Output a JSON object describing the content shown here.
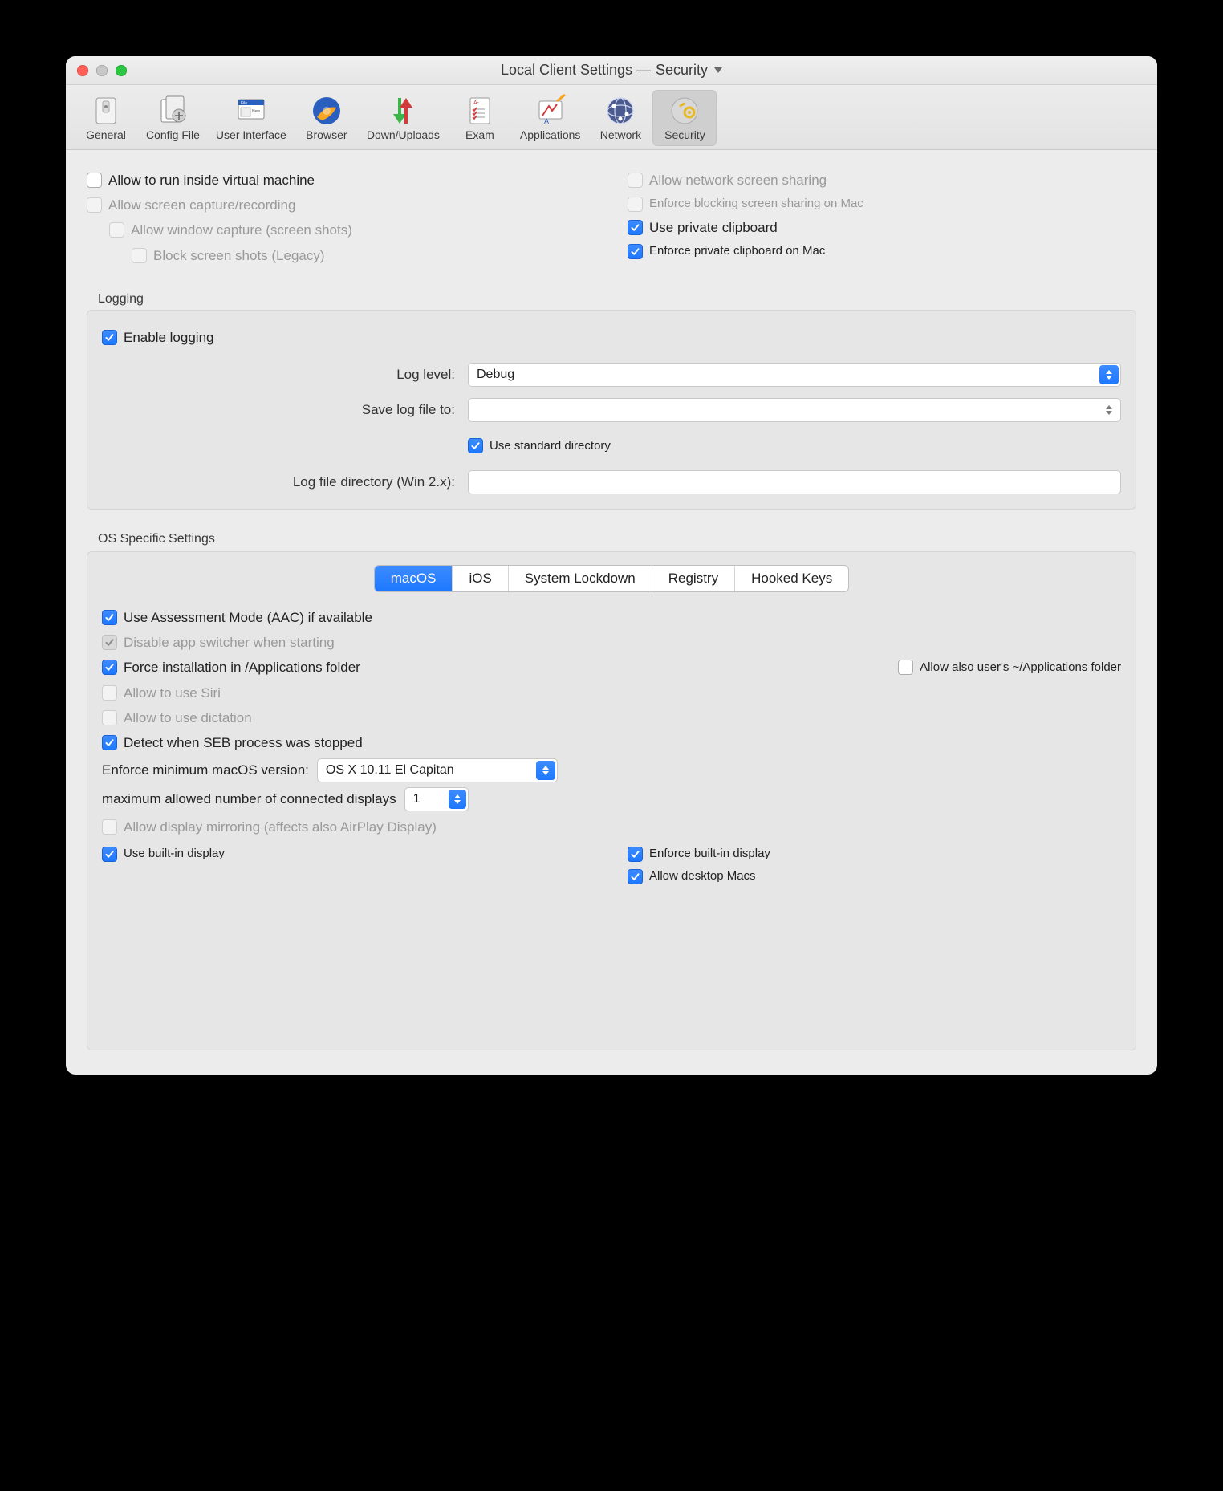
{
  "title": {
    "prefix": "Local Client Settings  —  ",
    "section": "Security"
  },
  "toolbar": [
    {
      "id": "general",
      "label": "General"
    },
    {
      "id": "config-file",
      "label": "Config File"
    },
    {
      "id": "user-interface",
      "label": "User Interface"
    },
    {
      "id": "browser",
      "label": "Browser"
    },
    {
      "id": "down-uploads",
      "label": "Down/Uploads"
    },
    {
      "id": "exam",
      "label": "Exam"
    },
    {
      "id": "applications",
      "label": "Applications"
    },
    {
      "id": "network",
      "label": "Network"
    },
    {
      "id": "security",
      "label": "Security",
      "selected": true
    }
  ],
  "top_left": [
    {
      "label": "Allow to run inside virtual machine",
      "checked": false,
      "enabled": true,
      "indent": 0
    },
    {
      "label": "Allow screen capture/recording",
      "checked": false,
      "enabled": false,
      "indent": 0
    },
    {
      "label": "Allow window capture (screen shots)",
      "checked": false,
      "enabled": false,
      "indent": 1
    },
    {
      "label": "Block screen shots (Legacy)",
      "checked": false,
      "enabled": false,
      "indent": 2
    }
  ],
  "top_right": [
    {
      "label": "Allow network screen sharing",
      "checked": false,
      "enabled": false
    },
    {
      "label": "Enforce blocking screen sharing on Mac",
      "checked": false,
      "enabled": false,
      "small": true
    },
    {
      "label": "Use private clipboard",
      "checked": true,
      "enabled": true
    },
    {
      "label": "Enforce private clipboard on Mac",
      "checked": true,
      "enabled": true,
      "small": true
    }
  ],
  "logging": {
    "section_label": "Logging",
    "enable_label": "Enable logging",
    "enable_checked": true,
    "log_level_label": "Log level:",
    "log_level_value": "Debug",
    "save_to_label": "Save log file to:",
    "save_to_value": "",
    "use_std_label": "Use standard directory",
    "use_std_checked": true,
    "win_dir_label": "Log file directory (Win 2.x):",
    "win_dir_value": ""
  },
  "os": {
    "section_label": "OS Specific Settings",
    "tabs": [
      "macOS",
      "iOS",
      "System Lockdown",
      "Registry",
      "Hooked Keys"
    ],
    "tab_selected": 0,
    "assessment_label": "Use Assessment Mode (AAC) if available",
    "assessment_checked": true,
    "disable_switcher_label": "Disable app switcher when starting",
    "disable_switcher_checked": true,
    "disable_switcher_enabled": false,
    "force_install_label": "Force installation in /Applications folder",
    "force_install_checked": true,
    "allow_user_apps_label": "Allow also user's ~/Applications folder",
    "allow_user_apps_checked": false,
    "allow_siri_label": "Allow to use Siri",
    "allow_siri_checked": false,
    "allow_siri_enabled": false,
    "allow_dict_label": "Allow to use dictation",
    "allow_dict_checked": false,
    "allow_dict_enabled": false,
    "detect_stopped_label": "Detect when SEB process was stopped",
    "detect_stopped_checked": true,
    "min_macos_label": "Enforce minimum macOS version:",
    "min_macos_value": "OS X 10.11 El Capitan",
    "max_displays_label": "maximum allowed number of connected displays",
    "max_displays_value": "1",
    "mirroring_label": "Allow display mirroring (affects also AirPlay Display)",
    "mirroring_checked": false,
    "mirroring_enabled": false,
    "use_builtin_label": "Use built-in display",
    "use_builtin_checked": true,
    "enforce_builtin_label": "Enforce built-in display",
    "enforce_builtin_checked": true,
    "allow_desktop_label": "Allow desktop Macs",
    "allow_desktop_checked": true
  }
}
